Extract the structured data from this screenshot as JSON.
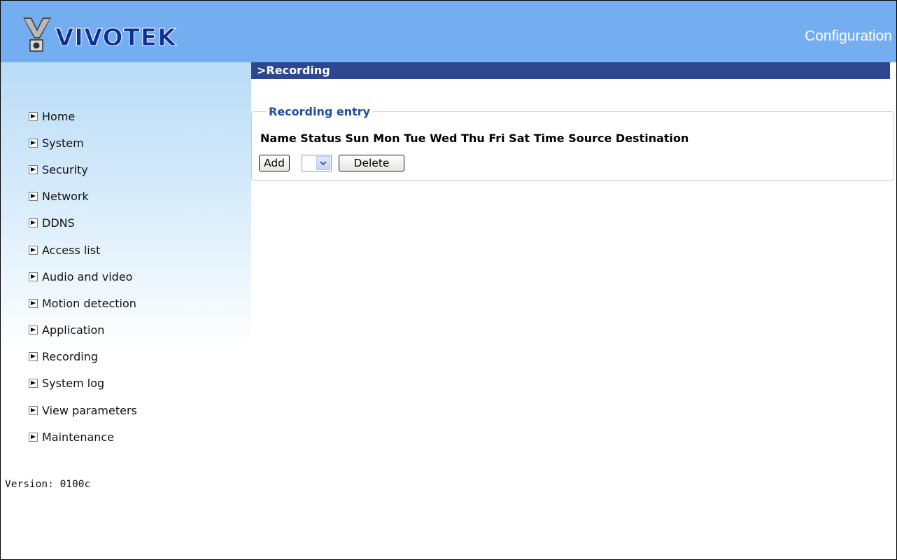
{
  "header": {
    "logo_text": "VIVOTEK",
    "title": "Configuration"
  },
  "section": {
    "title": ">Recording"
  },
  "sidebar": {
    "items": [
      {
        "label": "Home"
      },
      {
        "label": "System"
      },
      {
        "label": "Security"
      },
      {
        "label": "Network"
      },
      {
        "label": "DDNS"
      },
      {
        "label": "Access list"
      },
      {
        "label": "Audio and video"
      },
      {
        "label": "Motion detection"
      },
      {
        "label": "Application"
      },
      {
        "label": "Recording"
      },
      {
        "label": "System log"
      },
      {
        "label": "View parameters"
      },
      {
        "label": "Maintenance"
      }
    ],
    "version": "Version: 0100c"
  },
  "recording_entry": {
    "legend": "Recording entry",
    "columns": "Name Status Sun Mon Tue Wed Thu Fri Sat Time Source Destination",
    "add_label": "Add",
    "delete_label": "Delete",
    "select_value": ""
  },
  "colors": {
    "header_bg": "#74adf0",
    "section_bar_bg": "#2d4790",
    "legend_text": "#1f4fa8"
  },
  "icons": {
    "nav_bullet": "arrow-right-icon",
    "select_toggle": "chevron-down-icon"
  }
}
